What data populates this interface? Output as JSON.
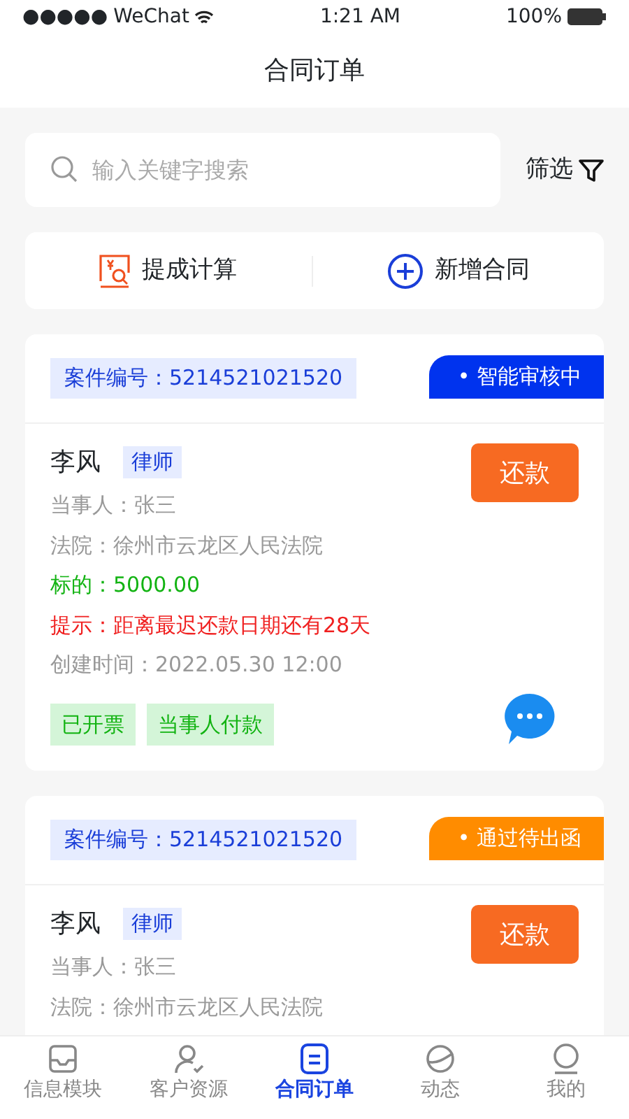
{
  "status_bar": {
    "signal": "●●●●●",
    "carrier": "WeChat",
    "time": "1:21 AM",
    "battery": "100%"
  },
  "title": "合同订单",
  "search": {
    "placeholder": "输入关键字搜索"
  },
  "filter": "筛选",
  "actions": [
    {
      "kind": "calc",
      "label": "提成计算"
    },
    {
      "kind": "add",
      "label": "新增合同"
    }
  ],
  "orders": [
    {
      "case_no": "案件编号：5214521021520",
      "status": "• 智能审核中",
      "color": "#0033ee",
      "name": "李风",
      "role": "律师",
      "button": "还款",
      "lines": [
        {
          "kind": "plain",
          "text": "当事人：张三"
        },
        {
          "kind": "plain",
          "text": "法院：徐州市云龙区人民法院"
        },
        {
          "kind": "amount",
          "text": "标的：5000.00"
        },
        {
          "kind": "warning",
          "text": "提示：距离最迟还款日期还有28天"
        },
        {
          "kind": "plain",
          "text": "创建时间：2022.05.30 12:00"
        }
      ],
      "tags": [
        "已开票",
        "当事人付款"
      ],
      "chat": true
    },
    {
      "case_no": "案件编号：5214521021520",
      "status": "• 通过待出函",
      "color": "#ff8c00",
      "name": "李风",
      "role": "律师",
      "button": "还款",
      "lines": [
        {
          "kind": "plain",
          "text": "当事人：张三"
        },
        {
          "kind": "plain",
          "text": "法院：徐州市云龙区人民法院"
        }
      ],
      "chat": false
    }
  ],
  "tabs": [
    {
      "kind": "inbox",
      "label": "信息模块",
      "selected": false
    },
    {
      "kind": "person",
      "label": "客户资源",
      "selected": false
    },
    {
      "kind": "doc",
      "label": "合同订单",
      "selected": true
    },
    {
      "kind": "planet",
      "label": "动态",
      "selected": false
    },
    {
      "kind": "me",
      "label": "我的",
      "selected": false
    }
  ]
}
